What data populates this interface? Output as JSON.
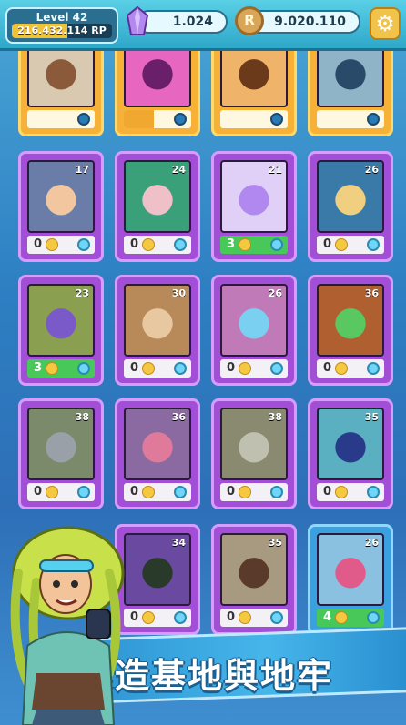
{
  "header": {
    "level_label": "Level 42",
    "rp_text": "216.432.114 RP",
    "rp_progress": 0.55,
    "gems": "1.024",
    "coins": "9.020.110",
    "settings_icon": "gear-icon",
    "gem_icon": "gem-icon",
    "coin_icon": "coin-icon"
  },
  "cards": [
    {
      "id": "c1",
      "style": "gold",
      "level": "",
      "count": "",
      "fill": 0.0,
      "row": 0,
      "col": 0
    },
    {
      "id": "c2",
      "style": "gold",
      "level": "",
      "count": "",
      "fill": 0.45,
      "row": 0,
      "col": 1
    },
    {
      "id": "c3",
      "style": "gold",
      "level": "",
      "count": "",
      "fill": 0.0,
      "row": 0,
      "col": 2
    },
    {
      "id": "c4",
      "style": "gold",
      "level": "",
      "count": "",
      "fill": 0.0,
      "row": 0,
      "col": 3
    },
    {
      "id": "c5",
      "style": "purple",
      "level": "17",
      "count": "0",
      "active": false,
      "row": 1,
      "col": 0
    },
    {
      "id": "c6",
      "style": "purple",
      "level": "24",
      "count": "0",
      "active": false,
      "row": 1,
      "col": 1
    },
    {
      "id": "c7",
      "style": "purple",
      "level": "21",
      "count": "3",
      "active": true,
      "row": 1,
      "col": 2
    },
    {
      "id": "c8",
      "style": "purple",
      "level": "26",
      "count": "0",
      "active": false,
      "row": 1,
      "col": 3
    },
    {
      "id": "c9",
      "style": "purple",
      "level": "23",
      "count": "3",
      "active": true,
      "row": 2,
      "col": 0
    },
    {
      "id": "c10",
      "style": "purple",
      "level": "30",
      "count": "0",
      "active": false,
      "row": 2,
      "col": 1
    },
    {
      "id": "c11",
      "style": "purple",
      "level": "26",
      "count": "0",
      "active": false,
      "row": 2,
      "col": 2
    },
    {
      "id": "c12",
      "style": "purple",
      "level": "36",
      "count": "0",
      "active": false,
      "row": 2,
      "col": 3
    },
    {
      "id": "c13",
      "style": "purple",
      "level": "38",
      "count": "0",
      "active": false,
      "row": 3,
      "col": 0
    },
    {
      "id": "c14",
      "style": "purple",
      "level": "36",
      "count": "0",
      "active": false,
      "row": 3,
      "col": 1
    },
    {
      "id": "c15",
      "style": "purple",
      "level": "38",
      "count": "0",
      "active": false,
      "row": 3,
      "col": 2
    },
    {
      "id": "c16",
      "style": "purple",
      "level": "35",
      "count": "0",
      "active": false,
      "row": 3,
      "col": 3
    },
    {
      "id": "c17",
      "style": "purple",
      "level": "34",
      "count": "0",
      "active": false,
      "row": 4,
      "col": 1
    },
    {
      "id": "c18",
      "style": "purple",
      "level": "35",
      "count": "0",
      "active": false,
      "row": 4,
      "col": 2
    },
    {
      "id": "c19",
      "style": "blue",
      "level": "26",
      "count": "4",
      "active": true,
      "row": 4,
      "col": 3
    }
  ],
  "banner": {
    "text": "建造基地與地牢"
  },
  "colors": {
    "accent_gold": "#f6b136",
    "accent_purple": "#a24ed6",
    "active_green": "#49c85a",
    "banner_blue": "#2a8fd0"
  }
}
